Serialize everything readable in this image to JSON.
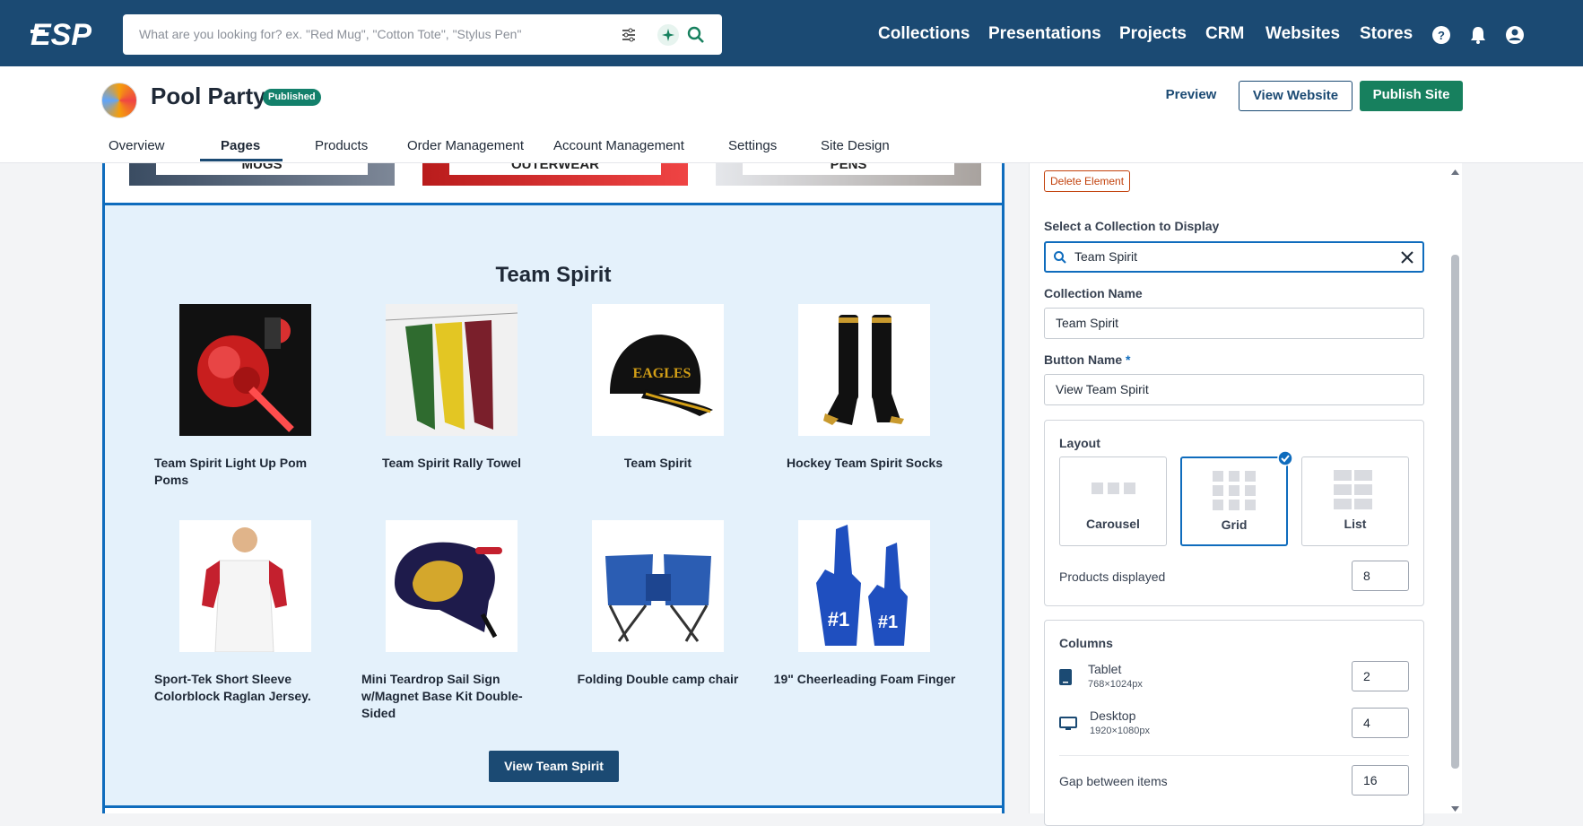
{
  "topbar": {
    "logo_text": "ESP",
    "search_placeholder": "What are you looking for? ex. \"Red Mug\", \"Cotton Tote\", \"Stylus Pen\"",
    "nav": [
      "Collections",
      "Presentations",
      "Projects",
      "CRM",
      "Websites",
      "Stores"
    ]
  },
  "header": {
    "title": "Pool Party",
    "badge": "Published",
    "preview": "Preview",
    "view_website": "View Website",
    "publish_site": "Publish Site",
    "tabs": [
      "Overview",
      "Pages",
      "Products",
      "Order Management",
      "Account Management",
      "Settings",
      "Site Design"
    ],
    "active_tab": "Pages"
  },
  "canvas": {
    "categories": [
      "MUGS",
      "OUTERWEAR",
      "PENS"
    ],
    "section_title": "Team Spirit",
    "products": [
      {
        "name": "Team Spirit Light Up Pom Poms"
      },
      {
        "name": "Team Spirit Rally Towel"
      },
      {
        "name": "Team Spirit"
      },
      {
        "name": "Hockey Team Spirit Socks"
      },
      {
        "name": "Sport-Tek Short Sleeve Colorblock Raglan Jersey."
      },
      {
        "name": "Mini Teardrop Sail Sign w/Magnet Base Kit Double-Sided"
      },
      {
        "name": "Folding Double camp chair"
      },
      {
        "name": "19\" Cheerleading Foam Finger"
      }
    ],
    "view_button": "View Team Spirit"
  },
  "panel": {
    "delete_element": "Delete Element",
    "select_collection_label": "Select a Collection to Display",
    "select_collection_value": "Team Spirit",
    "collection_name_label": "Collection Name",
    "collection_name_value": "Team Spirit",
    "button_name_label": "Button Name",
    "button_name_required": "*",
    "button_name_value": "View Team Spirit",
    "layout_label": "Layout",
    "layout_options": [
      "Carousel",
      "Grid",
      "List"
    ],
    "layout_selected": "Grid",
    "products_displayed_label": "Products displayed",
    "products_displayed_value": "8",
    "columns_label": "Columns",
    "tablet_label": "Tablet",
    "tablet_size": "768×1024px",
    "tablet_value": "2",
    "desktop_label": "Desktop",
    "desktop_size": "1920×1080px",
    "desktop_value": "4",
    "gap_label": "Gap between items",
    "gap_value": "16"
  },
  "colors": {
    "topbar": "#1b4a73",
    "publish": "#17805e",
    "selected_border": "#0f6cbd",
    "section_bg": "#e4f1fb"
  }
}
